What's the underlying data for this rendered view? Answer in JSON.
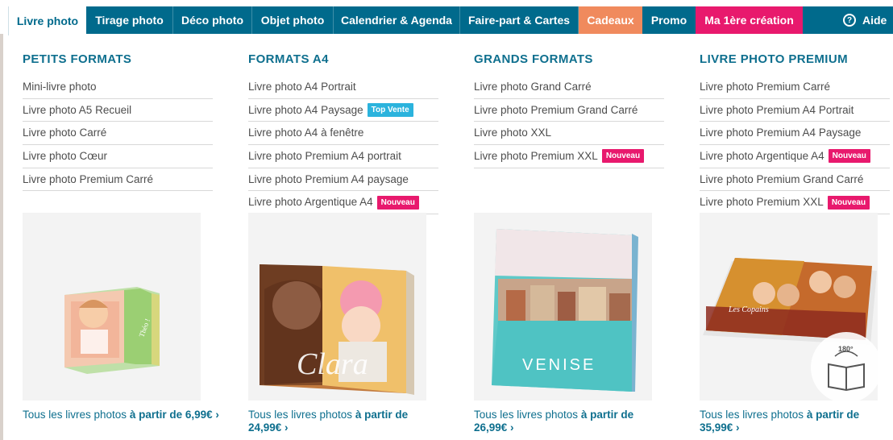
{
  "nav": {
    "tabs": [
      {
        "label": "Livre photo",
        "active": true
      },
      {
        "label": "Tirage photo"
      },
      {
        "label": "Déco photo"
      },
      {
        "label": "Objet photo"
      },
      {
        "label": "Calendrier & Agenda"
      },
      {
        "label": "Faire-part & Cartes"
      },
      {
        "label": "Cadeaux"
      },
      {
        "label": "Promo"
      },
      {
        "label": "Ma 1ère création"
      }
    ],
    "aide_label": "Aide",
    "aide_icon": "?"
  },
  "columns": [
    {
      "title": "PETITS FORMATS",
      "items": [
        {
          "label": "Mini-livre photo"
        },
        {
          "label": "Livre photo A5 Recueil"
        },
        {
          "label": "Livre photo Carré"
        },
        {
          "label": "Livre photo Cœur"
        },
        {
          "label": "Livre photo Premium Carré"
        }
      ],
      "image_text": "Théo !",
      "price_prefix": "Tous les livres photos ",
      "price_bold": "à partir de 6,99€ ›"
    },
    {
      "title": "FORMATS A4",
      "items": [
        {
          "label": "Livre photo A4 Portrait"
        },
        {
          "label": "Livre photo A4 Paysage",
          "badge": "Top Vente"
        },
        {
          "label": "Livre photo A4 à fenêtre"
        },
        {
          "label": "Livre photo Premium A4 portrait"
        },
        {
          "label": "Livre photo Premium A4 paysage"
        },
        {
          "label": "Livre photo Argentique A4",
          "badge": "Nouveau"
        }
      ],
      "image_text": "Clara",
      "price_prefix": "Tous les livres photos ",
      "price_bold": "à partir de 24,99€ ›"
    },
    {
      "title": "GRANDS FORMATS",
      "items": [
        {
          "label": "Livre photo Grand Carré"
        },
        {
          "label": "Livre photo Premium Grand Carré"
        },
        {
          "label": "Livre photo XXL"
        },
        {
          "label": "Livre photo Premium XXL",
          "badge": "Nouveau"
        }
      ],
      "image_text": "VENISE",
      "price_prefix": "Tous les livres photos ",
      "price_bold": "à partir de 26,99€ ›"
    },
    {
      "title": "LIVRE PHOTO PREMIUM",
      "items": [
        {
          "label": "Livre photo Premium Carré"
        },
        {
          "label": "Livre photo Premium A4 Portrait"
        },
        {
          "label": "Livre photo Premium A4 Paysage"
        },
        {
          "label": "Livre photo Argentique A4",
          "badge": "Nouveau"
        },
        {
          "label": "Livre photo Premium Grand Carré"
        },
        {
          "label": "Livre photo Premium XXL",
          "badge": "Nouveau"
        }
      ],
      "image_text": "Les Copains",
      "rotation_label": "180°",
      "price_prefix": "Tous les livres photos ",
      "price_bold": "à partir de 35,99€ ›"
    }
  ],
  "colors": {
    "nav_bg": "#006a8c",
    "title": "#0e6f8e",
    "badge_top": "#2bb3dd",
    "badge_new": "#e8196d",
    "cadeaux": "#f08a5d",
    "creation": "#e8196d"
  }
}
